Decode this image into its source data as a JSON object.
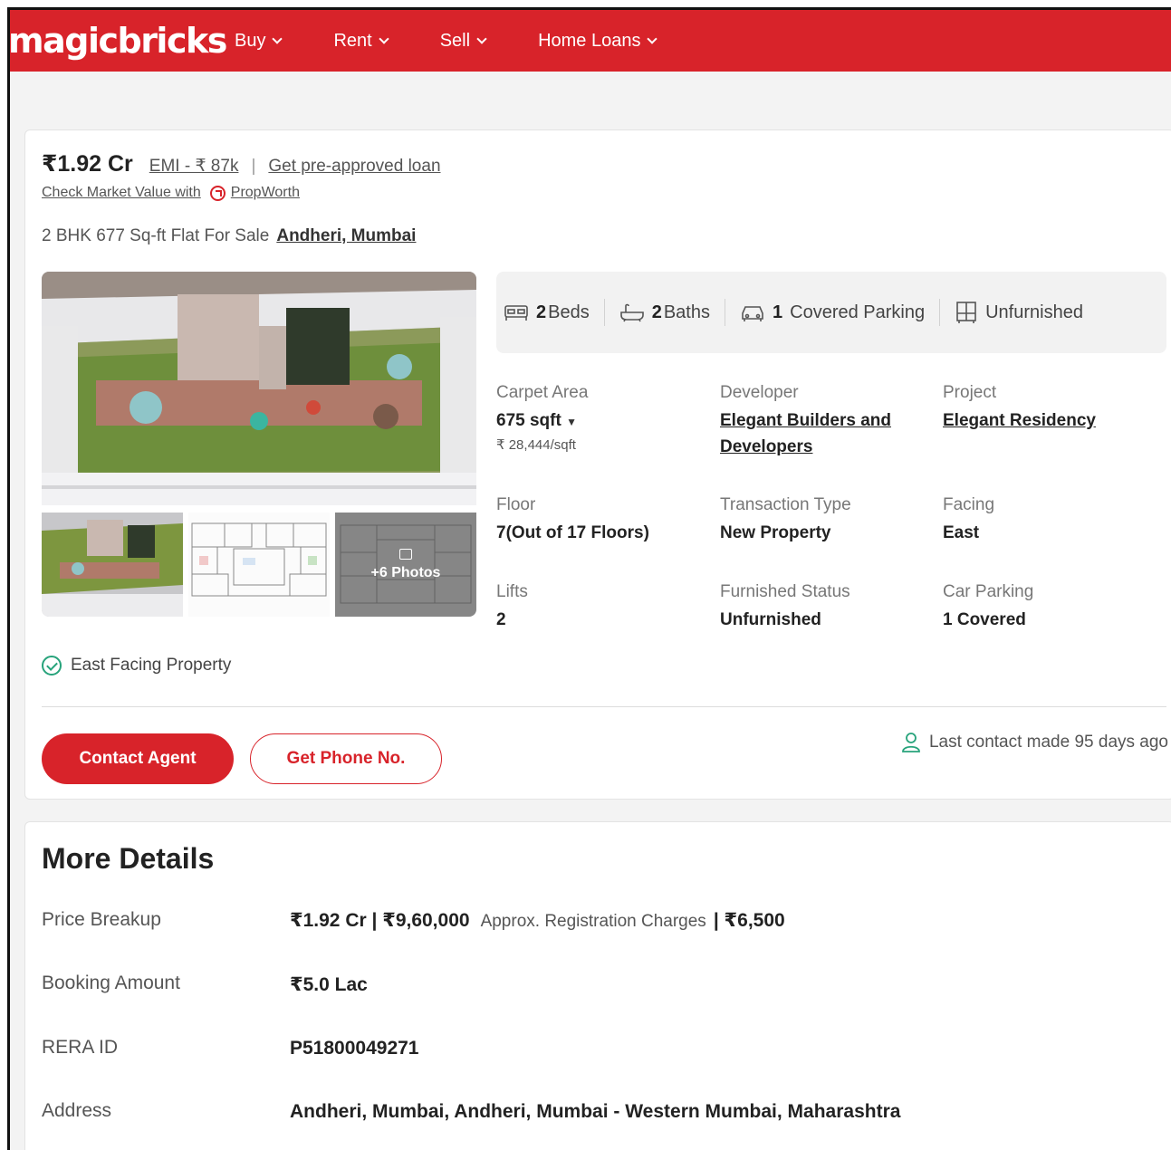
{
  "header": {
    "logo": "magicbricks",
    "nav": [
      {
        "label": "Buy"
      },
      {
        "label": "Rent"
      },
      {
        "label": "Sell"
      },
      {
        "label": "Home Loans"
      }
    ],
    "brand_color": "#d8232a"
  },
  "listing": {
    "price": "₹1.92 Cr",
    "emi": "EMI - ₹ 87k",
    "separator": "|",
    "loan_link": "Get pre-approved loan",
    "market_value_text": "Check Market Value with",
    "propworth": "PropWorth",
    "title": "2 BHK 677 Sq-ft Flat For Sale",
    "location": "Andheri, Mumbai",
    "more_photos": "+6 Photos",
    "summary": {
      "beds_num": "2",
      "beds_label": "Beds",
      "baths_num": "2",
      "baths_label": "Baths",
      "parking_num": "1",
      "parking_label": "Covered Parking",
      "furnishing": "Unfurnished"
    },
    "details": {
      "carpet_area_label": "Carpet Area",
      "carpet_area_value": "675 sqft",
      "price_per_sqft": "₹ 28,444/sqft",
      "developer_label": "Developer",
      "developer_value": "Elegant Builders and Developers",
      "project_label": "Project",
      "project_value": "Elegant Residency",
      "floor_label": "Floor",
      "floor_value": "7(Out of 17 Floors)",
      "transaction_label": "Transaction Type",
      "transaction_value": "New Property",
      "facing_label": "Facing",
      "facing_value": "East",
      "lifts_label": "Lifts",
      "lifts_value": "2",
      "furnished_label": "Furnished Status",
      "furnished_value": "Unfurnished",
      "car_parking_label": "Car Parking",
      "car_parking_value": "1 Covered"
    },
    "highlight": "East Facing Property",
    "contact_button": "Contact Agent",
    "phone_button": "Get Phone No.",
    "last_contact": "Last contact made 95 days ago"
  },
  "more_details": {
    "title": "More Details",
    "price_breakup_label": "Price Breakup",
    "price_breakup_price": "₹1.92 Cr | ₹9,60,000",
    "price_breakup_note": "Approx. Registration Charges",
    "price_breakup_extra": "| ₹6,500",
    "booking_label": "Booking Amount",
    "booking_value": "₹5.0 Lac",
    "rera_label": "RERA ID",
    "rera_value": "P51800049271",
    "address_label": "Address",
    "address_value": "Andheri, Mumbai, Andheri, Mumbai - Western Mumbai, Maharashtra"
  }
}
